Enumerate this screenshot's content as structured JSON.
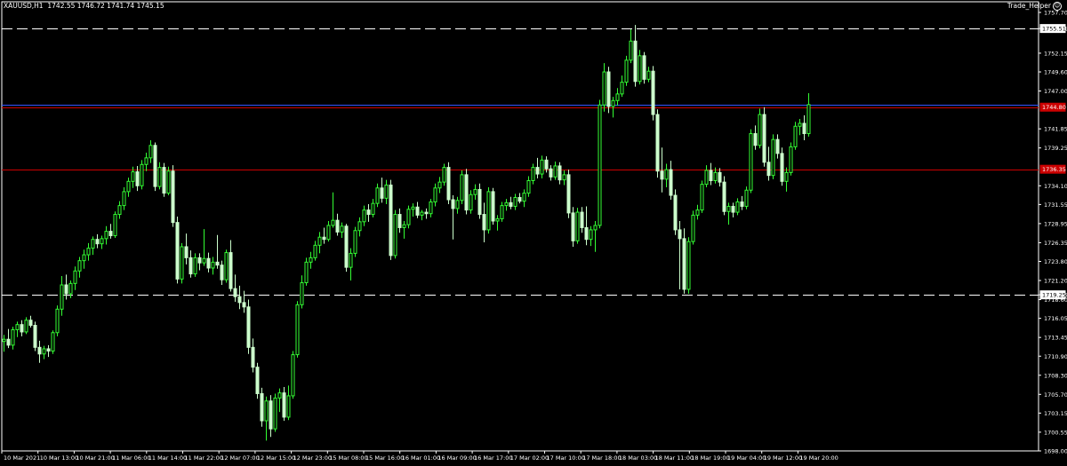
{
  "header": {
    "symbol": "XAUUSD,H1",
    "ohlc": "1742.55 1746.72 1741.74 1745.15",
    "indicator_name": "Trade_Helper"
  },
  "colors": {
    "background": "#000000",
    "candle_up": "#33ff33",
    "candle_down": "#ccffcc",
    "axis_text": "#ffffff",
    "level_dashed": "#ffffff",
    "level_red": "#cc0000",
    "level_blue": "#3355ff"
  },
  "chart_data": {
    "type": "candlestick",
    "y_axis": {
      "range": [
        1698.0,
        1757.7
      ],
      "ticks": [
        "1757.70",
        "1755.51",
        "1752.15",
        "1749.60",
        "1747.00",
        "1741.85",
        "1739.25",
        "1734.10",
        "1731.55",
        "1728.95",
        "1726.35",
        "1723.80",
        "1721.20",
        "1719.25",
        "1718.60",
        "1716.05",
        "1713.45",
        "1710.90",
        "1708.30",
        "1705.70",
        "1703.15",
        "1700.55",
        "1698.00"
      ]
    },
    "x_axis": {
      "labels": [
        "10 Mar 2021",
        "10 Mar 13:00",
        "10 Mar 21:00",
        "11 Mar 06:00",
        "11 Mar 14:00",
        "11 Mar 22:00",
        "12 Mar 07:00",
        "12 Mar 15:00",
        "12 Mar 23:00",
        "15 Mar 08:00",
        "15 Mar 16:00",
        "16 Mar 01:00",
        "16 Mar 09:00",
        "16 Mar 17:00",
        "17 Mar 02:00",
        "17 Mar 10:00",
        "17 Mar 18:00",
        "18 Mar 03:00",
        "18 Mar 11:00",
        "18 Mar 19:00",
        "19 Mar 04:00",
        "19 Mar 12:00",
        "19 Mar 20:00"
      ]
    },
    "levels": [
      {
        "price": 1755.51,
        "style": "dashed",
        "color": "#ffffff",
        "label": "1755.51"
      },
      {
        "price": 1719.25,
        "style": "dashed",
        "color": "#ffffff",
        "label": "1719.25"
      },
      {
        "price": 1744.8,
        "style": "solid",
        "color": "#cc0000",
        "label": "1744.80"
      },
      {
        "price": 1736.35,
        "style": "solid",
        "color": "#cc0000",
        "label": "1736.35"
      },
      {
        "price": 1745.15,
        "style": "solid",
        "color": "#3355ff",
        "label": ""
      }
    ],
    "candles": [
      [
        1712.9,
        1713.8,
        1711.5,
        1713.2
      ],
      [
        1713.2,
        1714.6,
        1712.0,
        1712.4
      ],
      [
        1712.4,
        1714.9,
        1711.8,
        1714.5
      ],
      [
        1714.5,
        1715.6,
        1713.5,
        1715.2
      ],
      [
        1715.2,
        1715.8,
        1713.6,
        1714.2
      ],
      [
        1714.2,
        1716.2,
        1713.9,
        1715.8
      ],
      [
        1715.8,
        1716.4,
        1714.8,
        1715.1
      ],
      [
        1715.1,
        1715.6,
        1711.6,
        1712.1
      ],
      [
        1712.1,
        1713.0,
        1710.0,
        1711.2
      ],
      [
        1711.2,
        1712.3,
        1710.5,
        1711.9
      ],
      [
        1711.9,
        1712.4,
        1710.8,
        1711.6
      ],
      [
        1711.6,
        1714.4,
        1711.2,
        1714.1
      ],
      [
        1714.1,
        1717.8,
        1713.6,
        1717.3
      ],
      [
        1717.3,
        1721.8,
        1716.4,
        1720.6
      ],
      [
        1720.6,
        1722.0,
        1718.6,
        1719.4
      ],
      [
        1719.4,
        1721.2,
        1718.8,
        1720.8
      ],
      [
        1720.8,
        1723.1,
        1719.9,
        1722.5
      ],
      [
        1722.5,
        1724.4,
        1721.6,
        1723.9
      ],
      [
        1723.9,
        1725.4,
        1722.8,
        1724.7
      ],
      [
        1724.7,
        1726.3,
        1723.9,
        1725.6
      ],
      [
        1725.6,
        1727.2,
        1724.7,
        1726.8
      ],
      [
        1726.8,
        1727.5,
        1725.6,
        1726.2
      ],
      [
        1726.2,
        1727.3,
        1725.5,
        1726.9
      ],
      [
        1726.9,
        1728.6,
        1726.1,
        1727.9
      ],
      [
        1727.9,
        1728.9,
        1726.9,
        1727.3
      ],
      [
        1727.3,
        1730.6,
        1727.0,
        1730.2
      ],
      [
        1730.2,
        1732.0,
        1729.6,
        1731.4
      ],
      [
        1731.4,
        1733.9,
        1730.8,
        1733.3
      ],
      [
        1733.3,
        1735.2,
        1732.6,
        1734.7
      ],
      [
        1734.7,
        1736.7,
        1733.8,
        1736.0
      ],
      [
        1736.0,
        1736.8,
        1733.4,
        1734.1
      ],
      [
        1734.1,
        1737.6,
        1733.6,
        1737.0
      ],
      [
        1737.0,
        1738.6,
        1736.1,
        1737.9
      ],
      [
        1737.9,
        1740.3,
        1737.2,
        1739.6
      ],
      [
        1739.6,
        1740.0,
        1733.4,
        1734.0
      ],
      [
        1734.0,
        1737.3,
        1733.6,
        1736.6
      ],
      [
        1736.6,
        1737.2,
        1732.6,
        1733.1
      ],
      [
        1733.1,
        1736.7,
        1732.8,
        1736.1
      ],
      [
        1736.1,
        1736.9,
        1728.5,
        1729.1
      ],
      [
        1729.1,
        1729.9,
        1720.8,
        1721.4
      ],
      [
        1721.4,
        1726.3,
        1720.8,
        1725.8
      ],
      [
        1725.8,
        1727.6,
        1723.4,
        1724.3
      ],
      [
        1724.3,
        1725.3,
        1721.6,
        1722.1
      ],
      [
        1722.1,
        1724.9,
        1721.7,
        1724.3
      ],
      [
        1724.3,
        1724.9,
        1722.6,
        1723.6
      ],
      [
        1723.6,
        1728.2,
        1723.2,
        1724.2
      ],
      [
        1724.2,
        1725.0,
        1722.3,
        1722.9
      ],
      [
        1722.9,
        1724.4,
        1722.0,
        1723.7
      ],
      [
        1723.7,
        1727.4,
        1722.8,
        1723.3
      ],
      [
        1723.3,
        1723.9,
        1720.6,
        1721.3
      ],
      [
        1721.3,
        1725.4,
        1720.9,
        1725.0
      ],
      [
        1725.0,
        1726.7,
        1719.7,
        1720.1
      ],
      [
        1720.1,
        1722.0,
        1718.3,
        1719.0
      ],
      [
        1719.0,
        1720.5,
        1717.3,
        1718.2
      ],
      [
        1718.2,
        1719.8,
        1716.8,
        1717.6
      ],
      [
        1717.6,
        1718.6,
        1711.2,
        1712.1
      ],
      [
        1712.1,
        1713.3,
        1708.7,
        1709.4
      ],
      [
        1709.4,
        1710.0,
        1705.1,
        1705.8
      ],
      [
        1705.8,
        1706.6,
        1701.3,
        1702.1
      ],
      [
        1702.1,
        1705.4,
        1699.4,
        1704.8
      ],
      [
        1704.8,
        1705.6,
        1699.9,
        1701.0
      ],
      [
        1701.0,
        1705.8,
        1700.6,
        1705.2
      ],
      [
        1705.2,
        1706.5,
        1703.3,
        1705.9
      ],
      [
        1705.9,
        1706.7,
        1702.1,
        1702.6
      ],
      [
        1702.6,
        1706.9,
        1702.2,
        1705.5
      ],
      [
        1705.5,
        1711.6,
        1705.1,
        1711.1
      ],
      [
        1711.1,
        1718.4,
        1710.7,
        1717.9
      ],
      [
        1717.9,
        1721.9,
        1717.4,
        1720.9
      ],
      [
        1720.9,
        1724.3,
        1720.5,
        1723.7
      ],
      [
        1723.7,
        1725.1,
        1722.8,
        1724.3
      ],
      [
        1724.3,
        1726.6,
        1723.9,
        1726.0
      ],
      [
        1726.0,
        1727.8,
        1724.9,
        1727.1
      ],
      [
        1727.1,
        1728.4,
        1726.2,
        1726.8
      ],
      [
        1726.8,
        1729.3,
        1726.5,
        1728.7
      ],
      [
        1728.7,
        1733.2,
        1728.4,
        1729.4
      ],
      [
        1729.4,
        1730.3,
        1727.3,
        1727.8
      ],
      [
        1727.8,
        1729.1,
        1727.0,
        1728.6
      ],
      [
        1728.6,
        1728.9,
        1722.4,
        1723.0
      ],
      [
        1723.0,
        1725.6,
        1721.2,
        1724.9
      ],
      [
        1724.9,
        1728.5,
        1724.4,
        1728.0
      ],
      [
        1728.0,
        1729.8,
        1727.2,
        1729.2
      ],
      [
        1729.2,
        1731.4,
        1728.6,
        1730.8
      ],
      [
        1730.8,
        1731.6,
        1729.2,
        1730.2
      ],
      [
        1730.2,
        1732.3,
        1729.8,
        1731.7
      ],
      [
        1731.7,
        1734.4,
        1731.2,
        1733.8
      ],
      [
        1733.8,
        1735.2,
        1731.8,
        1732.4
      ],
      [
        1732.4,
        1734.9,
        1731.6,
        1734.2
      ],
      [
        1734.2,
        1734.9,
        1724.0,
        1724.6
      ],
      [
        1724.6,
        1730.8,
        1724.2,
        1730.2
      ],
      [
        1730.2,
        1731.0,
        1727.7,
        1728.4
      ],
      [
        1728.4,
        1729.3,
        1726.9,
        1728.8
      ],
      [
        1728.8,
        1731.4,
        1728.3,
        1730.9
      ],
      [
        1730.9,
        1731.7,
        1729.9,
        1731.2
      ],
      [
        1731.2,
        1731.9,
        1729.7,
        1730.1
      ],
      [
        1730.1,
        1730.8,
        1729.4,
        1730.5
      ],
      [
        1730.5,
        1731.0,
        1729.6,
        1730.3
      ],
      [
        1730.3,
        1732.3,
        1729.8,
        1731.9
      ],
      [
        1731.9,
        1734.4,
        1731.3,
        1733.8
      ],
      [
        1733.8,
        1735.3,
        1733.1,
        1734.6
      ],
      [
        1734.6,
        1737.1,
        1734.1,
        1736.6
      ],
      [
        1736.6,
        1737.3,
        1731.6,
        1732.2
      ],
      [
        1732.2,
        1732.8,
        1726.8,
        1731.0
      ],
      [
        1731.0,
        1732.6,
        1730.3,
        1732.1
      ],
      [
        1732.1,
        1736.2,
        1731.6,
        1735.6
      ],
      [
        1735.6,
        1736.4,
        1730.2,
        1730.8
      ],
      [
        1730.8,
        1733.5,
        1730.3,
        1732.9
      ],
      [
        1732.9,
        1734.3,
        1732.2,
        1733.6
      ],
      [
        1733.6,
        1734.4,
        1729.6,
        1730.2
      ],
      [
        1730.2,
        1731.8,
        1726.4,
        1728.1
      ],
      [
        1728.1,
        1733.9,
        1727.6,
        1733.3
      ],
      [
        1733.3,
        1733.8,
        1728.8,
        1729.3
      ],
      [
        1729.3,
        1730.1,
        1728.0,
        1729.6
      ],
      [
        1729.6,
        1731.9,
        1729.2,
        1731.4
      ],
      [
        1731.4,
        1732.3,
        1730.7,
        1731.8
      ],
      [
        1731.8,
        1732.6,
        1730.9,
        1731.3
      ],
      [
        1731.3,
        1733.0,
        1730.8,
        1732.5
      ],
      [
        1732.5,
        1733.1,
        1731.7,
        1732.0
      ],
      [
        1732.0,
        1733.6,
        1731.2,
        1733.1
      ],
      [
        1733.1,
        1735.4,
        1732.6,
        1734.8
      ],
      [
        1734.8,
        1737.1,
        1734.3,
        1736.6
      ],
      [
        1736.6,
        1737.9,
        1735.1,
        1735.7
      ],
      [
        1735.7,
        1738.2,
        1735.1,
        1737.6
      ],
      [
        1737.6,
        1738.1,
        1735.9,
        1736.4
      ],
      [
        1736.4,
        1736.9,
        1734.8,
        1735.3
      ],
      [
        1735.3,
        1737.4,
        1734.9,
        1736.8
      ],
      [
        1736.8,
        1737.3,
        1734.3,
        1734.9
      ],
      [
        1734.9,
        1736.2,
        1734.2,
        1735.6
      ],
      [
        1735.6,
        1736.3,
        1729.7,
        1730.4
      ],
      [
        1730.4,
        1731.2,
        1725.8,
        1726.6
      ],
      [
        1726.6,
        1731.1,
        1726.2,
        1730.5
      ],
      [
        1730.5,
        1731.2,
        1727.7,
        1728.4
      ],
      [
        1728.4,
        1731.3,
        1726.0,
        1726.8
      ],
      [
        1726.8,
        1728.6,
        1725.9,
        1728.1
      ],
      [
        1728.1,
        1729.3,
        1725.1,
        1728.7
      ],
      [
        1728.7,
        1745.8,
        1728.3,
        1745.1
      ],
      [
        1745.1,
        1750.8,
        1744.2,
        1749.6
      ],
      [
        1749.6,
        1750.3,
        1744.0,
        1744.9
      ],
      [
        1744.9,
        1746.2,
        1743.4,
        1745.7
      ],
      [
        1745.7,
        1747.4,
        1745.0,
        1746.6
      ],
      [
        1746.6,
        1749.1,
        1746.2,
        1748.2
      ],
      [
        1748.2,
        1751.8,
        1747.7,
        1751.2
      ],
      [
        1751.2,
        1755.4,
        1750.8,
        1753.8
      ],
      [
        1753.8,
        1756.0,
        1747.6,
        1748.3
      ],
      [
        1748.3,
        1752.6,
        1747.9,
        1751.8
      ],
      [
        1751.8,
        1752.3,
        1748.0,
        1748.6
      ],
      [
        1748.6,
        1750.3,
        1748.2,
        1749.7
      ],
      [
        1749.7,
        1750.4,
        1743.0,
        1743.8
      ],
      [
        1743.8,
        1744.5,
        1735.2,
        1736.1
      ],
      [
        1736.1,
        1739.3,
        1733.2,
        1735.0
      ],
      [
        1735.0,
        1737.1,
        1733.9,
        1736.3
      ],
      [
        1736.3,
        1737.5,
        1732.2,
        1732.8
      ],
      [
        1732.8,
        1733.6,
        1727.4,
        1728.1
      ],
      [
        1728.1,
        1729.3,
        1720.0,
        1726.9
      ],
      [
        1726.9,
        1728.3,
        1719.4,
        1720.0
      ],
      [
        1720.0,
        1727.1,
        1719.4,
        1726.5
      ],
      [
        1726.5,
        1730.7,
        1726.1,
        1730.1
      ],
      [
        1730.1,
        1731.5,
        1729.5,
        1730.8
      ],
      [
        1730.8,
        1734.8,
        1730.4,
        1734.3
      ],
      [
        1734.3,
        1736.9,
        1733.9,
        1736.2
      ],
      [
        1736.2,
        1737.2,
        1734.2,
        1734.8
      ],
      [
        1734.8,
        1736.6,
        1734.4,
        1735.9
      ],
      [
        1735.9,
        1736.5,
        1734.0,
        1734.6
      ],
      [
        1734.6,
        1735.4,
        1730.1,
        1730.6
      ],
      [
        1730.6,
        1731.8,
        1728.8,
        1731.3
      ],
      [
        1731.3,
        1731.8,
        1729.8,
        1730.5
      ],
      [
        1730.5,
        1732.4,
        1730.1,
        1731.9
      ],
      [
        1731.9,
        1732.7,
        1730.8,
        1731.3
      ],
      [
        1731.3,
        1734.0,
        1730.9,
        1733.5
      ],
      [
        1733.5,
        1741.8,
        1733.1,
        1741.2
      ],
      [
        1741.2,
        1742.3,
        1739.0,
        1739.6
      ],
      [
        1739.6,
        1744.6,
        1739.2,
        1743.8
      ],
      [
        1743.8,
        1744.8,
        1736.7,
        1737.3
      ],
      [
        1737.3,
        1739.4,
        1734.8,
        1735.5
      ],
      [
        1735.5,
        1741.1,
        1735.0,
        1740.4
      ],
      [
        1740.4,
        1741.1,
        1737.8,
        1738.5
      ],
      [
        1738.5,
        1739.3,
        1734.1,
        1734.7
      ],
      [
        1734.7,
        1736.6,
        1733.3,
        1735.9
      ],
      [
        1735.9,
        1740.0,
        1735.5,
        1739.4
      ],
      [
        1739.4,
        1742.8,
        1739.0,
        1742.2
      ],
      [
        1742.2,
        1743.2,
        1741.0,
        1742.6
      ],
      [
        1742.6,
        1743.7,
        1740.3,
        1741.2
      ],
      [
        1741.2,
        1746.7,
        1740.8,
        1745.15
      ]
    ]
  }
}
